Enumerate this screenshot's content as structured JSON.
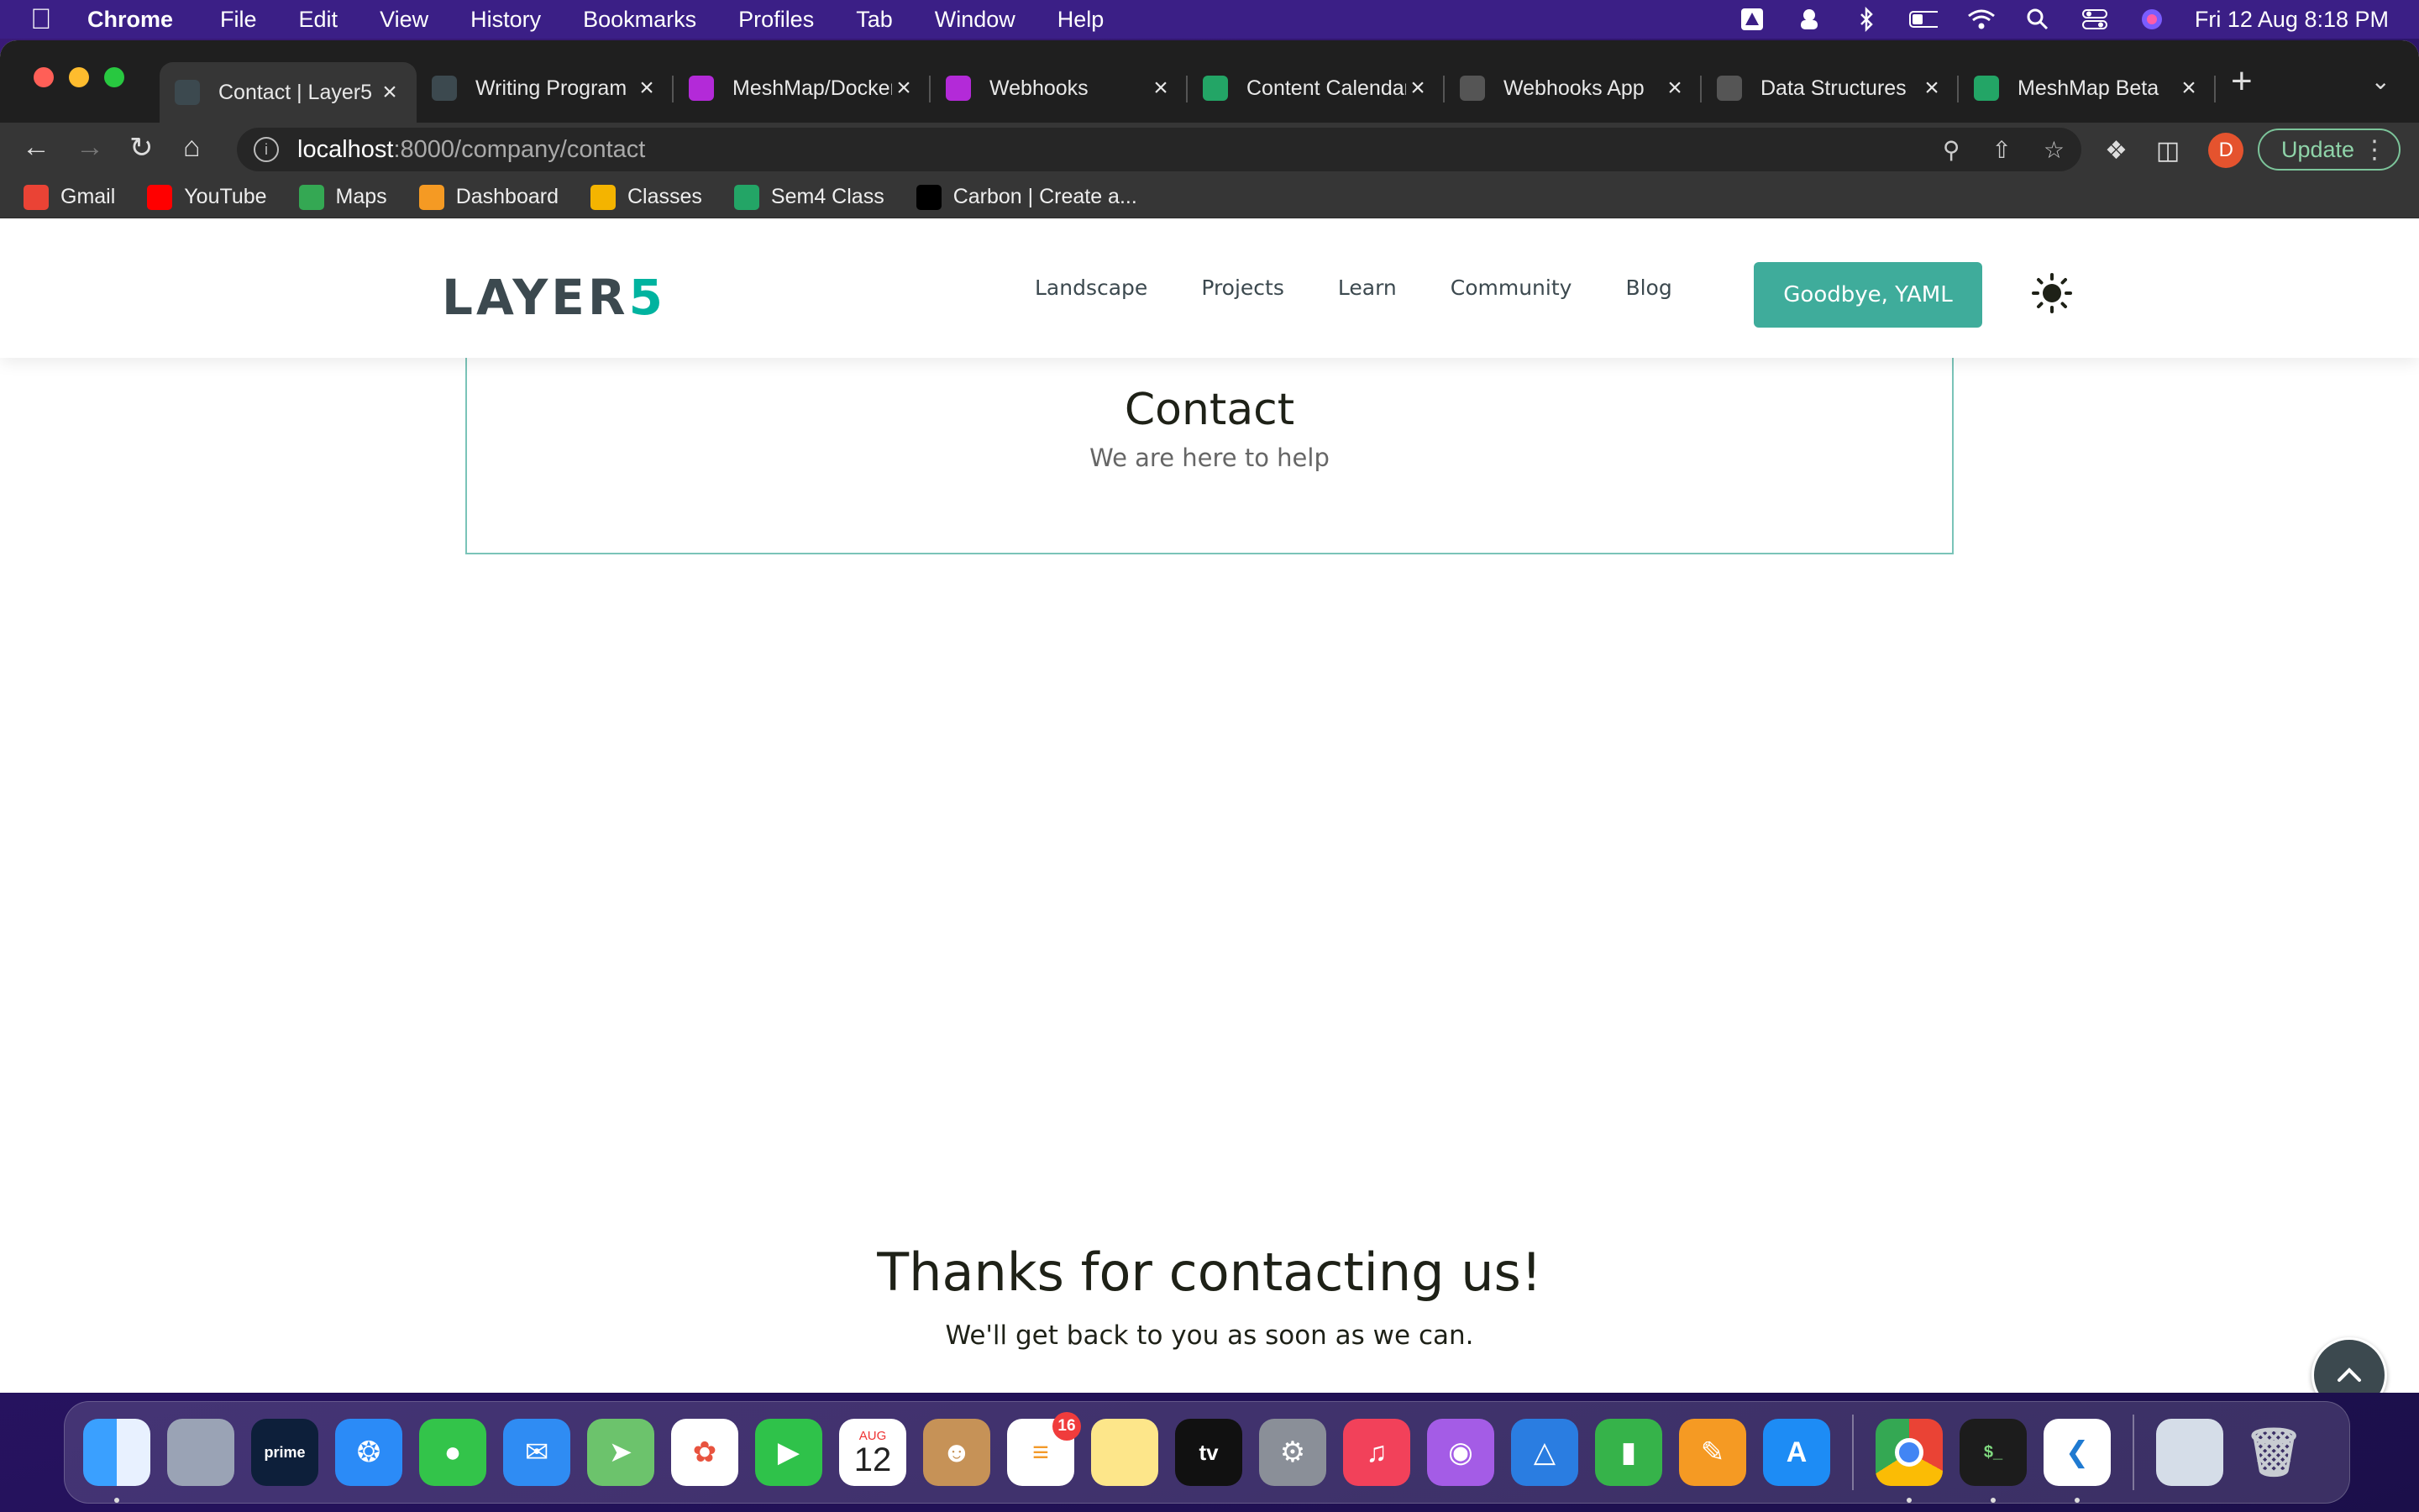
{
  "menubar": {
    "app_name": "Chrome",
    "menus": [
      "File",
      "Edit",
      "View",
      "History",
      "Bookmarks",
      "Profiles",
      "Tab",
      "Window",
      "Help"
    ],
    "clock": "Fri 12 Aug  8:18 PM"
  },
  "tabs": [
    {
      "title": "Contact | Layer5",
      "icon": "layer5-icon",
      "color": "#3c494f",
      "active": true
    },
    {
      "title": "Writing Program",
      "icon": "layer5-icon",
      "color": "#3c494f"
    },
    {
      "title": "MeshMap/Docker",
      "icon": "meshmap-icon",
      "color": "#b32ad8"
    },
    {
      "title": "Webhooks",
      "icon": "meshmap-icon",
      "color": "#b32ad8"
    },
    {
      "title": "Content Calendar",
      "icon": "sheets-icon",
      "color": "#23a566"
    },
    {
      "title": "Webhooks App",
      "icon": "power-icon",
      "color": "#555555"
    },
    {
      "title": "Data Structures",
      "icon": "power-icon",
      "color": "#555555"
    },
    {
      "title": "MeshMap Beta",
      "icon": "sheets-icon",
      "color": "#23a566"
    }
  ],
  "address": {
    "host": "localhost",
    "path": ":8000/company/contact"
  },
  "toolbar": {
    "update_label": "Update",
    "profile_initial": "D"
  },
  "bookmarks": [
    {
      "label": "Gmail",
      "icon": "gmail-icon",
      "color": "#ea4335"
    },
    {
      "label": "YouTube",
      "icon": "youtube-icon",
      "color": "#ff0000"
    },
    {
      "label": "Maps",
      "icon": "maps-icon",
      "color": "#34a853"
    },
    {
      "label": "Dashboard",
      "icon": "dashboard-icon",
      "color": "#f59a23"
    },
    {
      "label": "Classes",
      "icon": "classroom-icon",
      "color": "#f4b400"
    },
    {
      "label": "Sem4 Class",
      "icon": "sheets-icon",
      "color": "#23a566"
    },
    {
      "label": "Carbon | Create a...",
      "icon": "carbon-icon",
      "color": "#000000"
    }
  ],
  "site": {
    "logo_main": "LAYER",
    "logo_accent": "5",
    "nav": [
      "Landscape",
      "Projects",
      "Learn",
      "Community",
      "Blog"
    ],
    "cta_label": "Goodbye, YAML",
    "accent_color": "#3fac9b"
  },
  "contact": {
    "title": "Contact",
    "subtitle": "We are here to help"
  },
  "thanks": {
    "title": "Thanks for contacting us!",
    "subtitle": "We'll get back to you as soon as we can."
  },
  "dock": {
    "calendar_month": "AUG",
    "calendar_day": "12",
    "reminders_badge": "16",
    "apps": [
      "finder",
      "launchpad",
      "prime-video",
      "safari",
      "messages",
      "mail",
      "maps",
      "photos",
      "facetime",
      "calendar",
      "contacts",
      "reminders",
      "notes",
      "apple-tv",
      "system-preferences",
      "music",
      "podcasts",
      "keynote",
      "numbers",
      "pages",
      "app-store",
      "chrome",
      "terminal",
      "vscode",
      "downloads",
      "trash"
    ]
  }
}
